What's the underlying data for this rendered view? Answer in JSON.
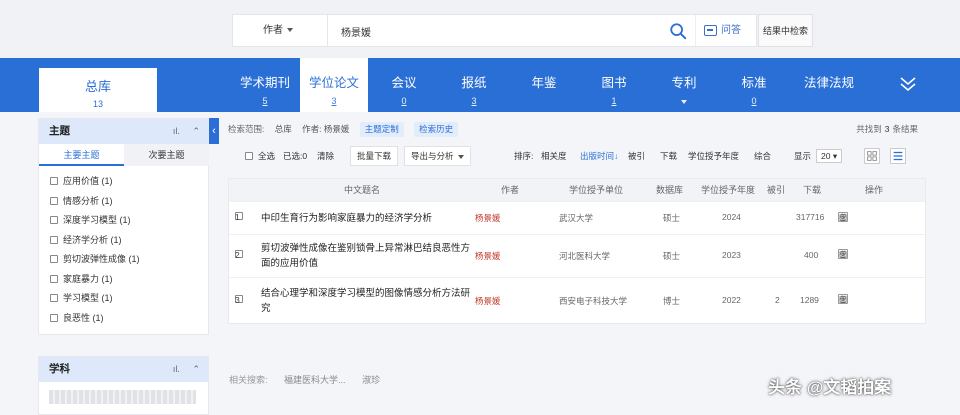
{
  "search": {
    "field": "作者",
    "query": "杨景媛",
    "qa_label": "问答",
    "in_result_label": "结果中检索"
  },
  "databases": {
    "main": {
      "label": "总库",
      "count": "13"
    },
    "tabs": [
      {
        "label": "学术期刊",
        "count": "5",
        "active": false
      },
      {
        "label": "学位论文",
        "count": "3",
        "active": true
      },
      {
        "label": "会议",
        "count": "0",
        "active": false
      },
      {
        "label": "报纸",
        "count": "3",
        "active": false
      },
      {
        "label": "年鉴",
        "count": "",
        "active": false
      },
      {
        "label": "图书",
        "count": "1",
        "active": false
      },
      {
        "label": "专利",
        "count": "",
        "active": false
      },
      {
        "label": "标准",
        "count": "0",
        "active": false
      },
      {
        "label": "法律法规",
        "count": "",
        "active": false
      }
    ]
  },
  "sidebar": {
    "topic_title": "主题",
    "tab_main": "主要主题",
    "tab_secondary": "次要主题",
    "topics": [
      "应用价值 (1)",
      "情感分析 (1)",
      "深度学习模型 (1)",
      "经济学分析 (1)",
      "剪切波弹性成像 (1)",
      "家庭暴力 (1)",
      "学习模型 (1)",
      "良恶性 (1)"
    ],
    "subject_title": "学科"
  },
  "scope": {
    "label": "检索范围:",
    "db": "总库",
    "author": "作者: 杨景媛",
    "topic_custom": "主题定制",
    "history": "检索历史",
    "found_prefix": "共找到",
    "found_count": "3",
    "found_suffix": "条结果"
  },
  "toolbar": {
    "select_all": "全选",
    "selected": "已选:",
    "selected_count": "0",
    "clear": "清除",
    "batch_download": "批量下载",
    "export": "导出与分析",
    "sort_label": "排序:",
    "sort_relevance": "相关度",
    "sort_time": "出版时间",
    "sort_cited": "被引",
    "sort_download": "下载",
    "sort_degree_year": "学位授予年度",
    "sort_combined": "综合",
    "display_label": "显示",
    "page_size": "20"
  },
  "table": {
    "headers": [
      "中文题名",
      "作者",
      "学位授予单位",
      "数据库",
      "学位授予年度",
      "被引",
      "下载",
      "操作"
    ],
    "rows": [
      {
        "num": "1",
        "title": "中印生育行为影响家庭暴力的经济学分析",
        "author": "杨景媛",
        "unit": "武汉大学",
        "db": "硕士",
        "year": "2024",
        "cited": "",
        "downloads": "317716"
      },
      {
        "num": "2",
        "title": "剪切波弹性成像在鉴别锁骨上异常淋巴结良恶性方面的应用价值",
        "author": "杨景媛",
        "unit": "河北医科大学",
        "db": "硕士",
        "year": "2023",
        "cited": "",
        "downloads": "400"
      },
      {
        "num": "3",
        "title": "结合心理学和深度学习模型的图像情感分析方法研究",
        "author": "杨景媛",
        "unit": "西安电子科技大学",
        "db": "博士",
        "year": "2022",
        "cited": "2",
        "downloads": "1289"
      }
    ]
  },
  "related": {
    "label": "相关搜索:",
    "item1": "福建医科大学...",
    "item2": "淑珍"
  },
  "watermark": "头条 @文韬拍案",
  "colors": {
    "brand_blue": "#2a6fd6",
    "author_red": "#c0392b"
  }
}
